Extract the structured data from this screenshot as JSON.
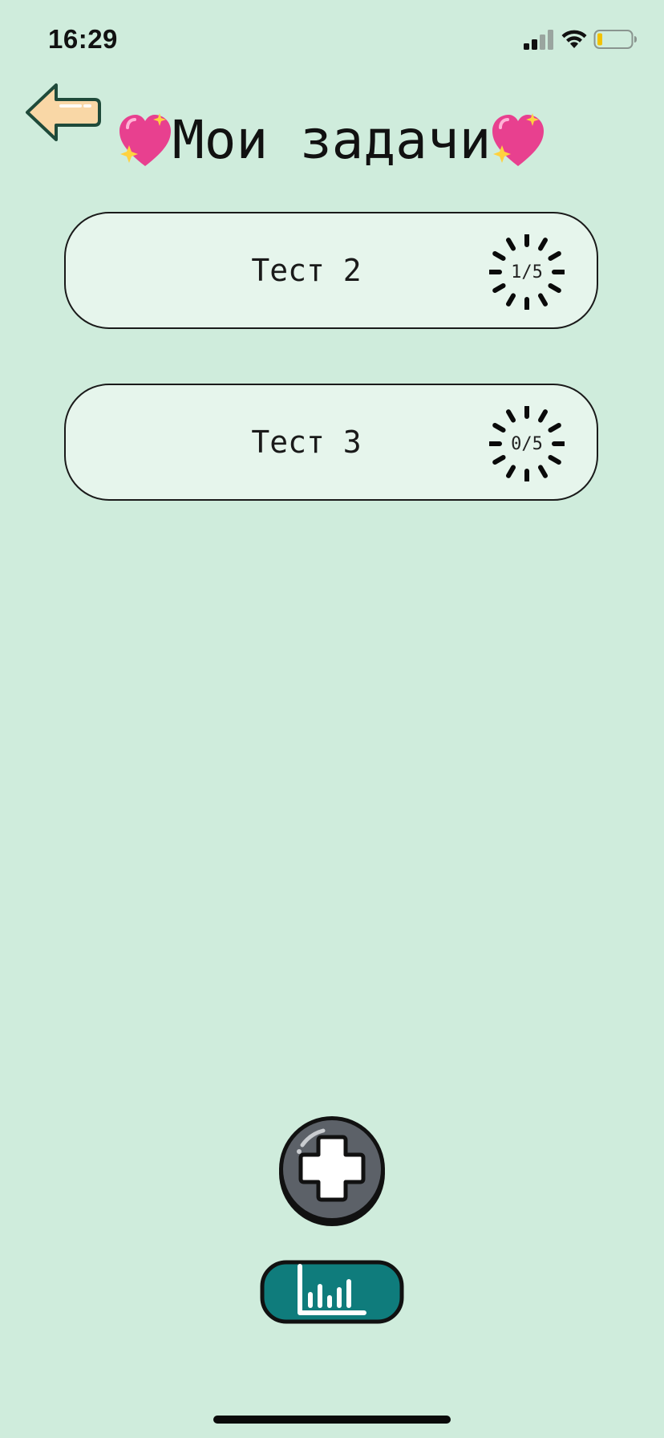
{
  "status_bar": {
    "time": "16:29",
    "icons": [
      "cellular-signal-icon",
      "wifi-icon",
      "battery-low-icon"
    ]
  },
  "header": {
    "back_icon": "arrow-left-icon",
    "title": "Мои задачи",
    "decor_icon": "sparkling-heart-icon"
  },
  "tasks": [
    {
      "title": "Тест 2",
      "progress_label": "1/5",
      "progress_done": 1,
      "progress_total": 5
    },
    {
      "title": "Тест 3",
      "progress_label": "0/5",
      "progress_done": 0,
      "progress_total": 5
    }
  ],
  "actions": {
    "add_icon": "plus-icon",
    "stats_icon": "bar-chart-icon"
  },
  "colors": {
    "background": "#cfecdc",
    "card_background": "#e6f5ec",
    "back_arrow_fill": "#f9d7a6",
    "back_arrow_stroke": "#1f4a3a",
    "add_button_fill": "#5c6168",
    "stats_button_fill": "#0f7c7c",
    "heart_pink": "#e8408f"
  }
}
